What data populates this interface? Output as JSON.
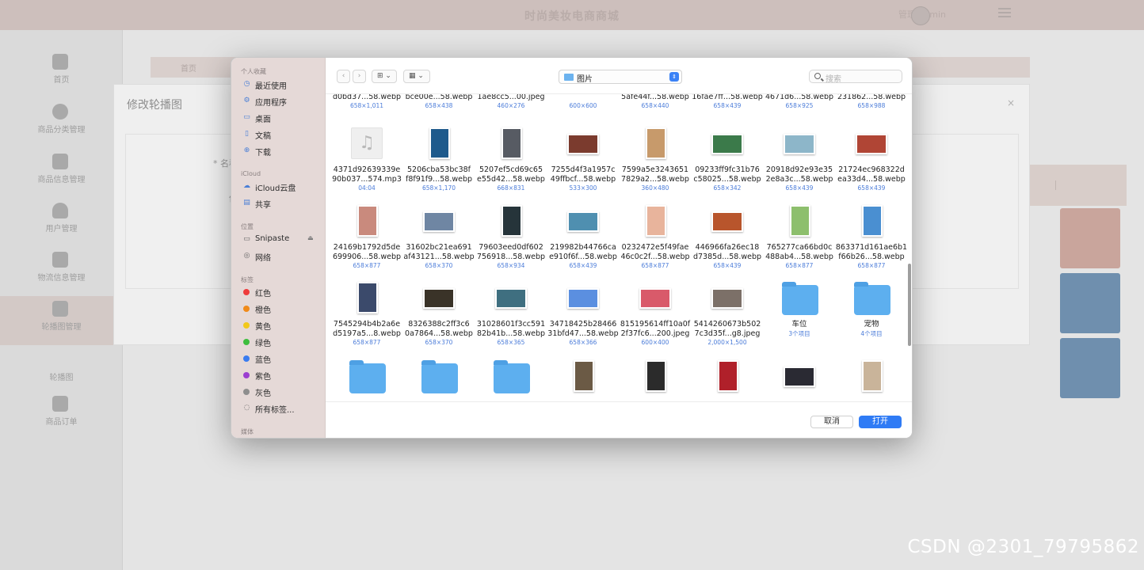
{
  "app": {
    "title": "时尚美妆电商商城",
    "user_text": "管理 admin",
    "content_breadcrumb": "首页",
    "sidebar": [
      {
        "label": "首页"
      },
      {
        "label": "商品分类管理"
      },
      {
        "label": "商品信息管理"
      },
      {
        "label": "用户管理"
      },
      {
        "label": "物流信息管理"
      },
      {
        "label": "轮播图管理"
      },
      {
        "label": "商品订单"
      }
    ],
    "sidebar_sub": "轮播图",
    "modal": {
      "title": "修改轮播图",
      "close": "×",
      "name_label": "* 名称",
      "value_label": "值"
    }
  },
  "dialog": {
    "location": "图片",
    "search_placeholder": "搜索",
    "nav_back": "‹",
    "nav_forward": "›",
    "view_icons": "⊞",
    "view_group": "▦",
    "cancel": "取消",
    "open": "打开",
    "sidebar": {
      "favorites_header": "个人收藏",
      "favorites": [
        {
          "label": "最近使用",
          "icon": "clock-icon"
        },
        {
          "label": "应用程序",
          "icon": "apps-icon"
        },
        {
          "label": "桌面",
          "icon": "desktop-icon"
        },
        {
          "label": "文稿",
          "icon": "document-icon"
        },
        {
          "label": "下载",
          "icon": "download-icon"
        }
      ],
      "icloud_header": "iCloud",
      "icloud": [
        {
          "label": "iCloud云盘",
          "icon": "cloud-icon"
        },
        {
          "label": "共享",
          "icon": "shared-folder-icon"
        }
      ],
      "locations_header": "位置",
      "locations": [
        {
          "label": "Snipaste",
          "icon": "drive-icon"
        },
        {
          "label": "网络",
          "icon": "network-icon"
        }
      ],
      "tags_header": "标签",
      "tags": [
        {
          "label": "红色",
          "color": "#ee3b3b"
        },
        {
          "label": "橙色",
          "color": "#f08a1a"
        },
        {
          "label": "黄色",
          "color": "#f2c81a"
        },
        {
          "label": "绿色",
          "color": "#3dbd3d"
        },
        {
          "label": "蓝色",
          "color": "#3a7cf0"
        },
        {
          "label": "紫色",
          "color": "#9b3fd0"
        },
        {
          "label": "灰色",
          "color": "#8e8e8e"
        }
      ],
      "all_tags": "所有标签...",
      "media_header": "媒体"
    },
    "files_row0": [
      {
        "name": "d0bd37...58.webp",
        "meta": "658×1,011"
      },
      {
        "name": "bce00e...58.webp",
        "meta": "658×438"
      },
      {
        "name": "1ae8cc5...00.jpeg",
        "meta": "460×276"
      },
      {
        "name": "",
        "meta": "600×600"
      },
      {
        "name": "5afe44f...58.webp",
        "meta": "658×440"
      },
      {
        "name": "16fae7ff...58.webp",
        "meta": "658×439"
      },
      {
        "name": "4671d6...58.webp",
        "meta": "658×925"
      },
      {
        "name": "231862...58.webp",
        "meta": "658×988"
      }
    ],
    "files_row1": [
      {
        "name1": "4371d92639339e",
        "name2": "90b037...574.mp3",
        "meta": "04:04",
        "kind": "music",
        "color": ""
      },
      {
        "name1": "5206cba53bc38f",
        "name2": "f8f91f9...58.webp",
        "meta": "658×1,170",
        "kind": "img-tall",
        "color": "#1e5a8c"
      },
      {
        "name1": "5207ef5cd69c65",
        "name2": "e55d42...58.webp",
        "meta": "668×831",
        "kind": "img-tall",
        "color": "#575b63"
      },
      {
        "name1": "7255d4f3a1957c",
        "name2": "49ffbcf...58.webp",
        "meta": "533×300",
        "kind": "img-wide",
        "color": "#7b3b2e"
      },
      {
        "name1": "7599a5e3243651",
        "name2": "7829a2...58.webp",
        "meta": "360×480",
        "kind": "img-tall",
        "color": "#c79a6b"
      },
      {
        "name1": "09233ff9fc31b76",
        "name2": "c58025...58.webp",
        "meta": "658×342",
        "kind": "img-wide",
        "color": "#3b7a4a"
      },
      {
        "name1": "20918d92e93e35",
        "name2": "2e8a3c...58.webp",
        "meta": "658×439",
        "kind": "img-wide",
        "color": "#8db6c9"
      },
      {
        "name1": "21724ec968322d",
        "name2": "ea33d4...58.webp",
        "meta": "658×439",
        "kind": "img-wide",
        "color": "#b04535"
      }
    ],
    "files_row2": [
      {
        "name1": "24169b1792d5de",
        "name2": "699906...58.webp",
        "meta": "658×877",
        "kind": "img-tall",
        "color": "#c98a7d"
      },
      {
        "name1": "31602bc21ea691",
        "name2": "af43121...58.webp",
        "meta": "658×370",
        "kind": "img-wide",
        "color": "#6f86a3"
      },
      {
        "name1": "79603eed0df602",
        "name2": "756918...58.webp",
        "meta": "658×934",
        "kind": "img-tall",
        "color": "#26343a"
      },
      {
        "name1": "219982b44766ca",
        "name2": "e910f6f...58.webp",
        "meta": "658×439",
        "kind": "img-wide",
        "color": "#4f8fb0"
      },
      {
        "name1": "0232472e5f49fae",
        "name2": "46c0c2f...58.webp",
        "meta": "658×877",
        "kind": "img-tall",
        "color": "#e8b49c"
      },
      {
        "name1": "446966fa26ec18",
        "name2": "d7385d...58.webp",
        "meta": "658×439",
        "kind": "img-wide",
        "color": "#b8552c"
      },
      {
        "name1": "765277ca66bd0c",
        "name2": "488ab4...58.webp",
        "meta": "658×877",
        "kind": "img-tall",
        "color": "#8dbf6d"
      },
      {
        "name1": "863371d161ae6b1",
        "name2": "f66b26...58.webp",
        "meta": "658×877",
        "kind": "img-tall",
        "color": "#4a8fd1"
      }
    ],
    "files_row3": [
      {
        "name1": "7545294b4b2a6e",
        "name2": "d5197a5...8.webp",
        "meta": "658×877",
        "kind": "img-tall",
        "color": "#3b4a6b"
      },
      {
        "name1": "8326388c2ff3c6",
        "name2": "0a7864...58.webp",
        "meta": "658×370",
        "kind": "img-wide",
        "color": "#3a3328"
      },
      {
        "name1": "31028601f3cc591",
        "name2": "82b41b...58.webp",
        "meta": "658×365",
        "kind": "img-wide",
        "color": "#3f6f80"
      },
      {
        "name1": "34718425b28466",
        "name2": "31bfd47...58.webp",
        "meta": "658×366",
        "kind": "img-wide",
        "color": "#5b8fe0"
      },
      {
        "name1": "815195614ff10a0f",
        "name2": "2f37fc6...200.jpeg",
        "meta": "600×400",
        "kind": "img-wide",
        "color": "#d95a6a"
      },
      {
        "name1": "5414260673b502",
        "name2": "7c3d35f...g8.jpeg",
        "meta": "2,000×1,500",
        "kind": "img-wide",
        "color": "#7c7068"
      },
      {
        "name1": "车位",
        "name2": "",
        "meta": "3个项目",
        "kind": "folder",
        "color": ""
      },
      {
        "name1": "宠物",
        "name2": "",
        "meta": "4个项目",
        "kind": "folder",
        "color": ""
      }
    ],
    "files_row4": [
      {
        "name1": "",
        "kind": "folder",
        "color": ""
      },
      {
        "name1": "",
        "kind": "folder",
        "color": ""
      },
      {
        "name1": "",
        "kind": "folder",
        "color": ""
      },
      {
        "name1": "",
        "kind": "img-tall",
        "color": "#6b5a45"
      },
      {
        "name1": "",
        "kind": "img-tall",
        "color": "#2b2b2b"
      },
      {
        "name1": "",
        "kind": "img-tall",
        "color": "#b0202a"
      },
      {
        "name1": "",
        "kind": "img-wide",
        "color": "#2a2a33"
      },
      {
        "name1": "",
        "kind": "img-tall",
        "color": "#c9b49a"
      }
    ]
  },
  "watermark": "CSDN @2301_79795862"
}
